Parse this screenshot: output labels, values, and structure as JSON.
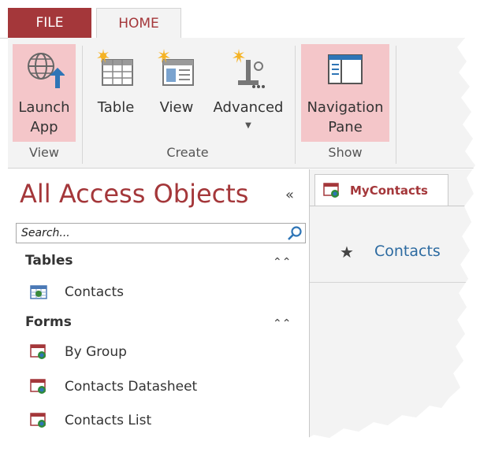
{
  "ribbon_tabs": {
    "file": "FILE",
    "home": "HOME"
  },
  "ribbon": {
    "launch_app": {
      "line1": "Launch",
      "line2": "App"
    },
    "table": "Table",
    "view": "View",
    "advanced": "Advanced",
    "navigation_pane": {
      "line1": "Navigation",
      "line2": "Pane"
    },
    "groups": {
      "view": "View",
      "create": "Create",
      "show": "Show"
    }
  },
  "nav_pane": {
    "title": "All Access Objects",
    "collapse_glyph": "«",
    "search_placeholder": "Search...",
    "sections": [
      {
        "label": "Tables",
        "items": [
          "Contacts"
        ]
      },
      {
        "label": "Forms",
        "items": [
          "By Group",
          "Contacts Datasheet",
          "Contacts List"
        ]
      }
    ]
  },
  "document": {
    "tab_label": "MyContacts",
    "tile_label": "Contacts"
  },
  "colors": {
    "accent": "#a4373a",
    "highlight": "#f4c6c9",
    "link": "#2c6aa0"
  }
}
